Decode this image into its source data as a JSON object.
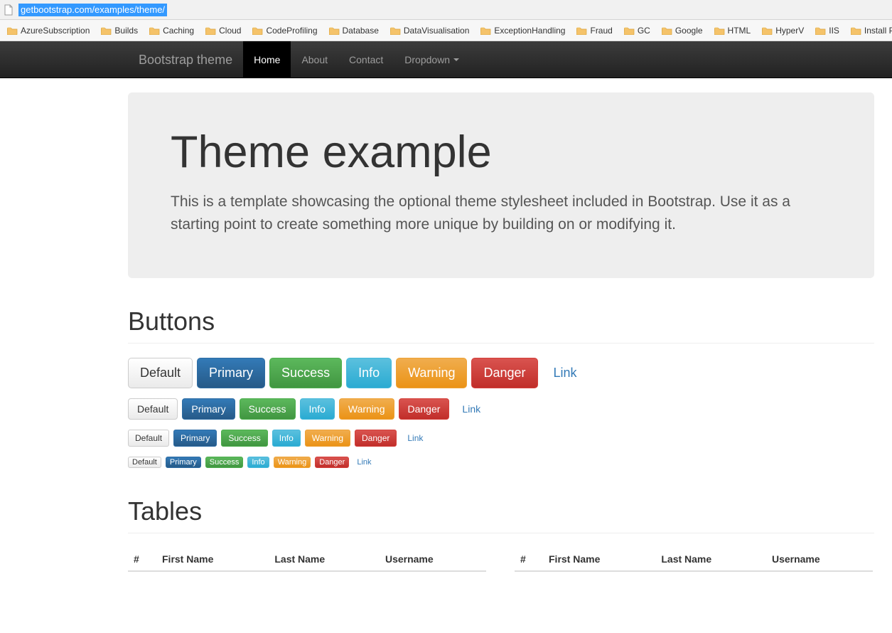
{
  "browser": {
    "url": "getbootstrap.com/examples/theme/"
  },
  "bookmarks": [
    "AzureSubscription",
    "Builds",
    "Caching",
    "Cloud",
    "CodeProfiling",
    "Database",
    "DataVisualisation",
    "ExceptionHandling",
    "Fraud",
    "GC",
    "Google",
    "HTML",
    "HyperV",
    "IIS",
    "Install Problems"
  ],
  "navbar": {
    "brand": "Bootstrap theme",
    "items": [
      "Home",
      "About",
      "Contact",
      "Dropdown"
    ],
    "active": 0,
    "dropdown_index": 3
  },
  "jumbotron": {
    "title": "Theme example",
    "lead": "This is a template showcasing the optional theme stylesheet included in Bootstrap. Use it as a starting point to create something more unique by building on or modifying it."
  },
  "sections": {
    "buttons_header": "Buttons",
    "tables_header": "Tables"
  },
  "buttons": {
    "labels": {
      "default": "Default",
      "primary": "Primary",
      "success": "Success",
      "info": "Info",
      "warning": "Warning",
      "danger": "Danger",
      "link": "Link"
    }
  },
  "table": {
    "headers": {
      "hash": "#",
      "first_name": "First Name",
      "last_name": "Last Name",
      "username": "Username"
    }
  }
}
